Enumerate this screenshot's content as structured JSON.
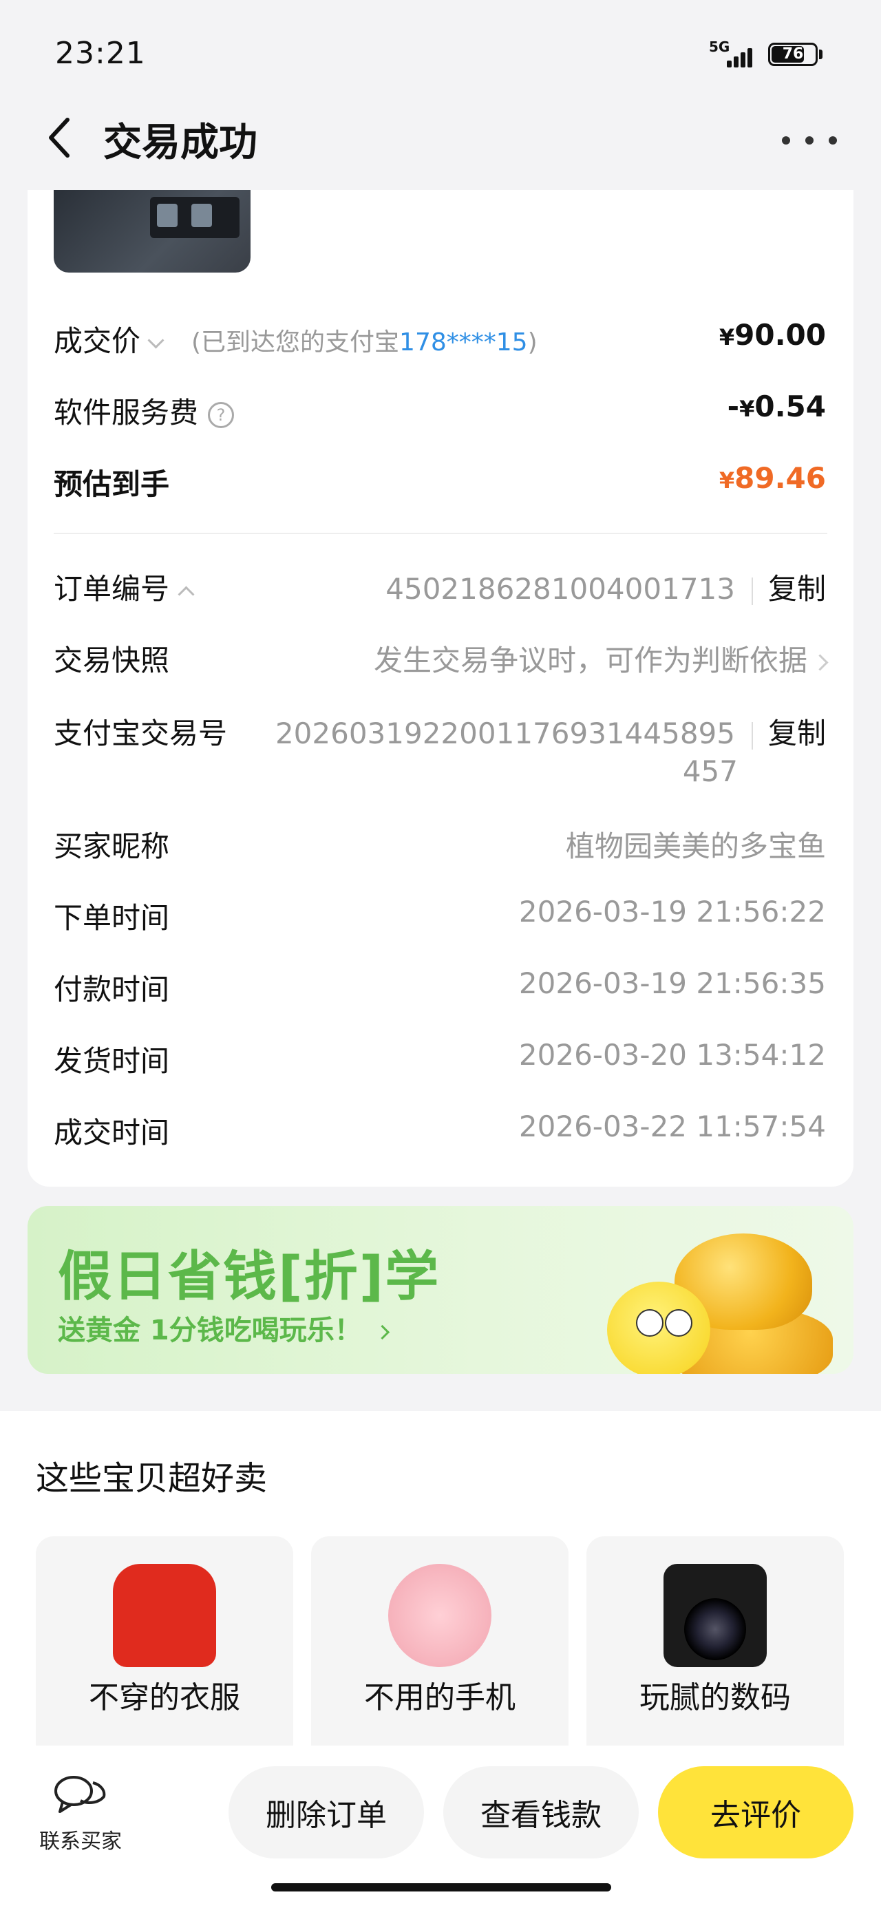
{
  "status_bar": {
    "time": "23:21",
    "network": "5G",
    "battery": "76",
    "battery_level": 0.76
  },
  "nav": {
    "title": "交易成功"
  },
  "price": {
    "deal_label": "成交价",
    "deal_note_prefix": "(已到达您的支付宝",
    "deal_note_account": "178****15",
    "deal_note_suffix": ")",
    "deal_amount": "90.00",
    "fee_label": "软件服务费",
    "fee_amount": "0.54",
    "fee_prefix": "-",
    "net_label": "预估到手",
    "net_amount": "89.46",
    "currency": "¥"
  },
  "order": {
    "order_no_label": "订单编号",
    "order_no": "4502186281004001713",
    "copy_label": "复制",
    "snapshot_label": "交易快照",
    "snapshot_text": "发生交易争议时，可作为判断依据",
    "alipay_no_label": "支付宝交易号",
    "alipay_no_line1": "2026031922001176931445895",
    "alipay_no_line2": "457",
    "buyer_label": "买家昵称",
    "buyer_name": "植物园美美的多宝鱼",
    "order_time_label": "下单时间",
    "order_time": "2026-03-19 21:56:22",
    "pay_time_label": "付款时间",
    "pay_time": "2026-03-19 21:56:35",
    "ship_time_label": "发货时间",
    "ship_time": "2026-03-20 13:54:12",
    "deal_time_label": "成交时间",
    "deal_time": "2026-03-22 11:57:54"
  },
  "banner": {
    "title": "假日省钱[折]学",
    "subtitle": "送黄金 1分钱吃喝玩乐！"
  },
  "recommend": {
    "title": "这些宝贝超好卖",
    "items": [
      {
        "label": "不穿的衣服",
        "icon": "sweater-icon"
      },
      {
        "label": "不用的手机",
        "icon": "phone-icon"
      },
      {
        "label": "玩腻的数码",
        "icon": "camera-icon"
      }
    ]
  },
  "bottom_bar": {
    "contact_label": "联系买家",
    "delete_label": "删除订单",
    "view_money_label": "查看钱款",
    "review_label": "去评价"
  },
  "colors": {
    "accent_orange": "#f06a25",
    "link_blue": "#2f8fe5",
    "review_yellow": "#ffe33a",
    "banner_green": "#5cb84a"
  }
}
